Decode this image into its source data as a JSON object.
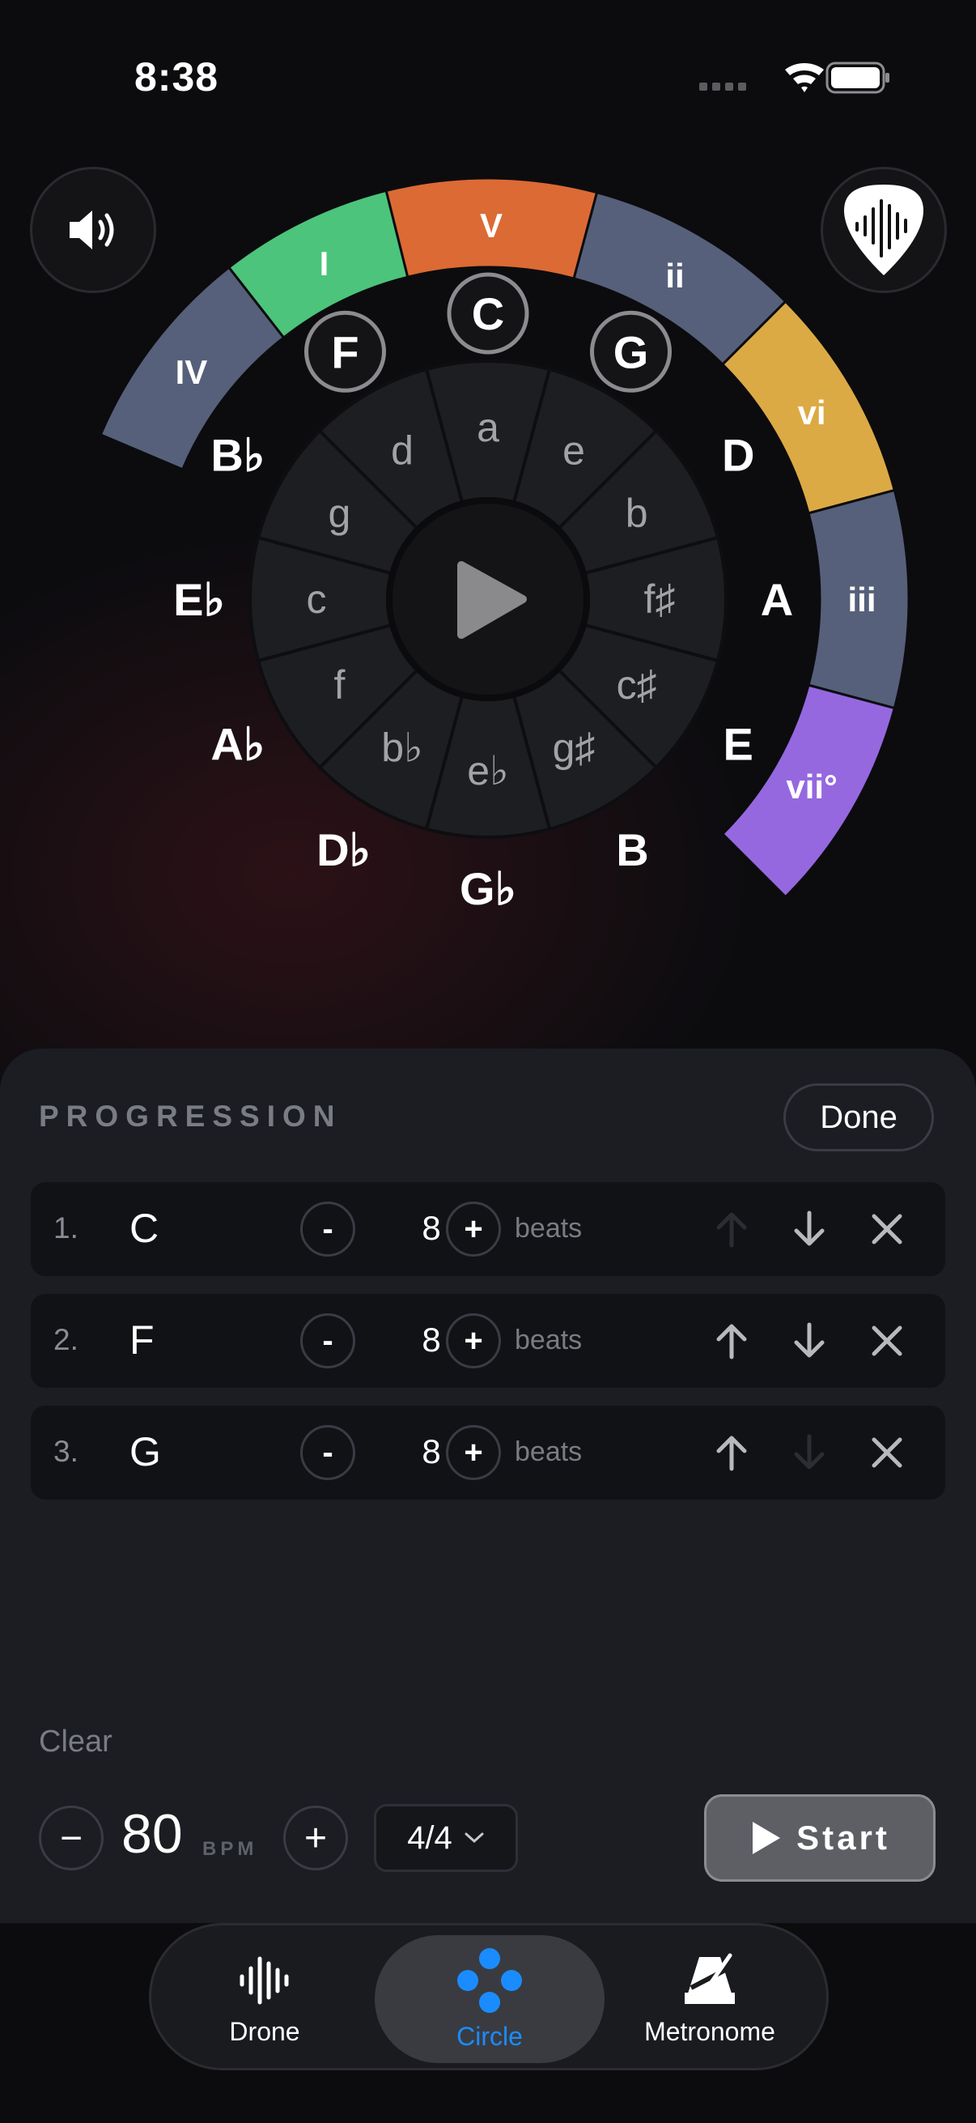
{
  "status": {
    "time": "8:38"
  },
  "circle": {
    "degrees": [
      {
        "label": "IV",
        "color": "#56607a",
        "a0": -67,
        "a1": -38
      },
      {
        "label": "I",
        "color": "#4cc47b",
        "a0": -38,
        "a1": -14
      },
      {
        "label": "V",
        "color": "#dc6a34",
        "a0": -14,
        "a1": 15
      },
      {
        "label": "ii",
        "color": "#56607a",
        "a0": 15,
        "a1": 45
      },
      {
        "label": "vi",
        "color": "#dcaa44",
        "a0": 45,
        "a1": 75
      },
      {
        "label": "iii",
        "color": "#56607a",
        "a0": 75,
        "a1": 105
      },
      {
        "label": "vii°",
        "color": "#9568e0",
        "a0": 105,
        "a1": 135
      }
    ],
    "major_keys": [
      {
        "label": "C",
        "highlighted": true
      },
      {
        "label": "G",
        "highlighted": true
      },
      {
        "label": "D",
        "highlighted": false
      },
      {
        "label": "A",
        "highlighted": false
      },
      {
        "label": "E",
        "highlighted": false
      },
      {
        "label": "B",
        "highlighted": false
      },
      {
        "label": "G♭",
        "highlighted": false
      },
      {
        "label": "D♭",
        "highlighted": false
      },
      {
        "label": "A♭",
        "highlighted": false
      },
      {
        "label": "E♭",
        "highlighted": false
      },
      {
        "label": "B♭",
        "highlighted": false
      },
      {
        "label": "F",
        "highlighted": true
      }
    ],
    "minor_keys": [
      "a",
      "e",
      "b",
      "f♯",
      "c♯",
      "g♯",
      "e♭",
      "b♭",
      "f",
      "c",
      "g",
      "d"
    ]
  },
  "panel": {
    "title": "PROGRESSION",
    "done_label": "Done",
    "rows": [
      {
        "index": "1.",
        "chord": "C",
        "minus": "-",
        "beats": "8",
        "plus": "+",
        "beats_label": "beats",
        "up_enabled": false,
        "down_enabled": true
      },
      {
        "index": "2.",
        "chord": "F",
        "minus": "-",
        "beats": "8",
        "plus": "+",
        "beats_label": "beats",
        "up_enabled": true,
        "down_enabled": true
      },
      {
        "index": "3.",
        "chord": "G",
        "minus": "-",
        "beats": "8",
        "plus": "+",
        "beats_label": "beats",
        "up_enabled": true,
        "down_enabled": false
      }
    ],
    "clear_label": "Clear"
  },
  "transport": {
    "minus": "−",
    "bpm": "80",
    "bpm_unit": "BPM",
    "plus": "+",
    "meter": "4/4",
    "start_label": "Start"
  },
  "tabs": [
    {
      "label": "Drone",
      "icon": "waveform-icon",
      "active": false
    },
    {
      "label": "Circle",
      "icon": "circle-dots-icon",
      "active": true
    },
    {
      "label": "Metronome",
      "icon": "metronome-icon",
      "active": false
    }
  ],
  "colors": {
    "accent": "#1a8cff",
    "background": "#0c0c0f",
    "panel": "#1b1d23"
  }
}
